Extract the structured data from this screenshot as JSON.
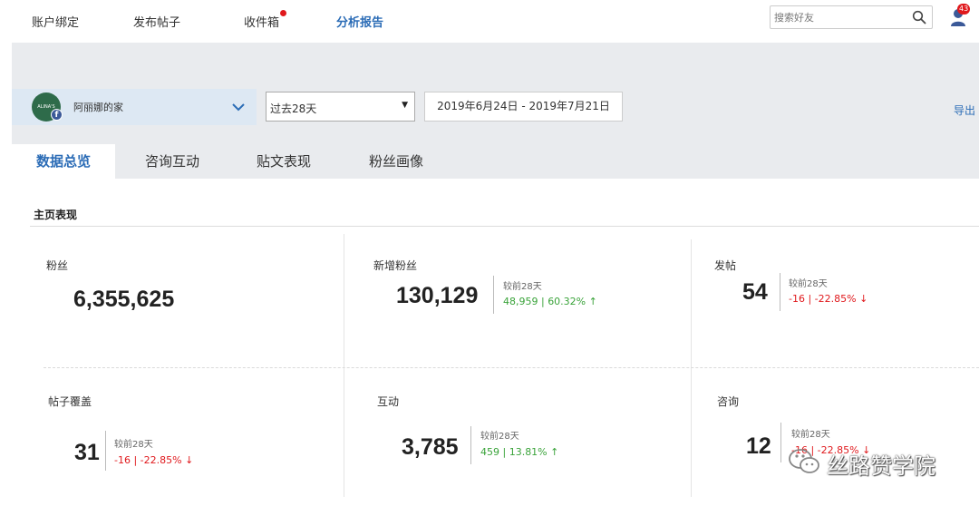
{
  "nav": {
    "items": [
      {
        "label": "账户绑定"
      },
      {
        "label": "发布帖子"
      },
      {
        "label": "收件箱",
        "has_dot": true
      },
      {
        "label": "分析报告",
        "active": true
      }
    ],
    "search_placeholder": "搜索好友",
    "notification_count": "43"
  },
  "account": {
    "name": "阿丽娜的家",
    "avatar_text": "ALINA'S HOUSE"
  },
  "filters": {
    "period": "过去28天",
    "date_range": "2019年6月24日 - 2019年7月21日",
    "export_label": "导出"
  },
  "tabs": [
    {
      "label": "数据总览",
      "active": true
    },
    {
      "label": "咨询互动"
    },
    {
      "label": "贴文表现"
    },
    {
      "label": "粉丝画像"
    }
  ],
  "section_title": "主页表现",
  "metrics": {
    "fans": {
      "label": "粉丝",
      "value": "6,355,625"
    },
    "new_fans": {
      "label": "新增粉丝",
      "value": "130,129",
      "compare_label": "较前28天",
      "compare_value": "48,959 | 60.32% ↑",
      "trend": "up"
    },
    "posts": {
      "label": "发帖",
      "value": "54",
      "compare_label": "较前28天",
      "compare_value": "-16 | -22.85% ↓",
      "trend": "down"
    },
    "reach": {
      "label": "帖子覆盖",
      "value": "31",
      "compare_label": "较前28天",
      "compare_value": "-16 | -22.85% ↓",
      "trend": "down"
    },
    "engagement": {
      "label": "互动",
      "value": "3,785",
      "compare_label": "较前28天",
      "compare_value": "459 | 13.81% ↑",
      "trend": "up"
    },
    "inquiries": {
      "label": "咨询",
      "value": "12",
      "compare_label": "较前28天",
      "compare_value": "-16 | -22.85% ↓",
      "trend": "down"
    }
  },
  "watermark": "丝路赞学院",
  "colors": {
    "accent": "#2b6cb6",
    "up": "#3aa33a",
    "down": "#e0191d",
    "band": "#e9ebee"
  }
}
